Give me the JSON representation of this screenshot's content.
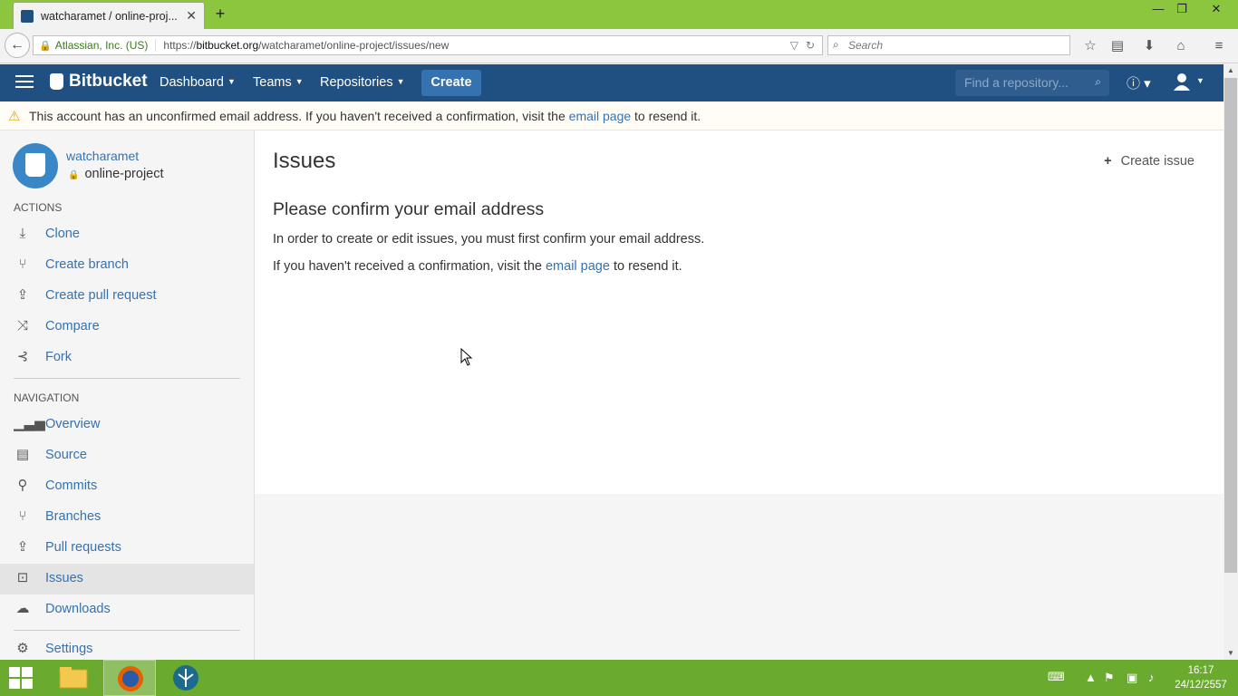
{
  "browser": {
    "tab_title": "watcharamet / online-proj...",
    "identity": "Atlassian, Inc. (US)",
    "url_prefix": "https://",
    "url_host": "bitbucket.org",
    "url_path": "/watcharamet/online-project/issues/new",
    "search_placeholder": "Search"
  },
  "header": {
    "logo": "Bitbucket",
    "nav": [
      "Dashboard",
      "Teams",
      "Repositories"
    ],
    "create_label": "Create",
    "search_placeholder": "Find a repository..."
  },
  "banner": {
    "text_before": "This account has an unconfirmed email address. If you haven't received a confirmation, visit the ",
    "link": "email page",
    "text_after": " to resend it."
  },
  "sidebar": {
    "owner": "watcharamet",
    "repo": "online-project",
    "actions_heading": "ACTIONS",
    "actions": [
      "Clone",
      "Create branch",
      "Create pull request",
      "Compare",
      "Fork"
    ],
    "navigation_heading": "NAVIGATION",
    "navigation": [
      "Overview",
      "Source",
      "Commits",
      "Branches",
      "Pull requests",
      "Issues",
      "Downloads"
    ],
    "settings": "Settings",
    "active_item": "Issues"
  },
  "main": {
    "title": "Issues",
    "create_issue": "Create issue",
    "confirm_heading": "Please confirm your email address",
    "para1": "In order to create or edit issues, you must first confirm your email address.",
    "para2_before": "If you haven't received a confirmation, visit the ",
    "para2_link": "email page",
    "para2_after": " to resend it."
  },
  "taskbar": {
    "time": "16:17",
    "date": "24/12/2557"
  },
  "colors": {
    "header_bg": "#205081",
    "link": "#3572b0",
    "titlebar": "#8cc63f"
  }
}
